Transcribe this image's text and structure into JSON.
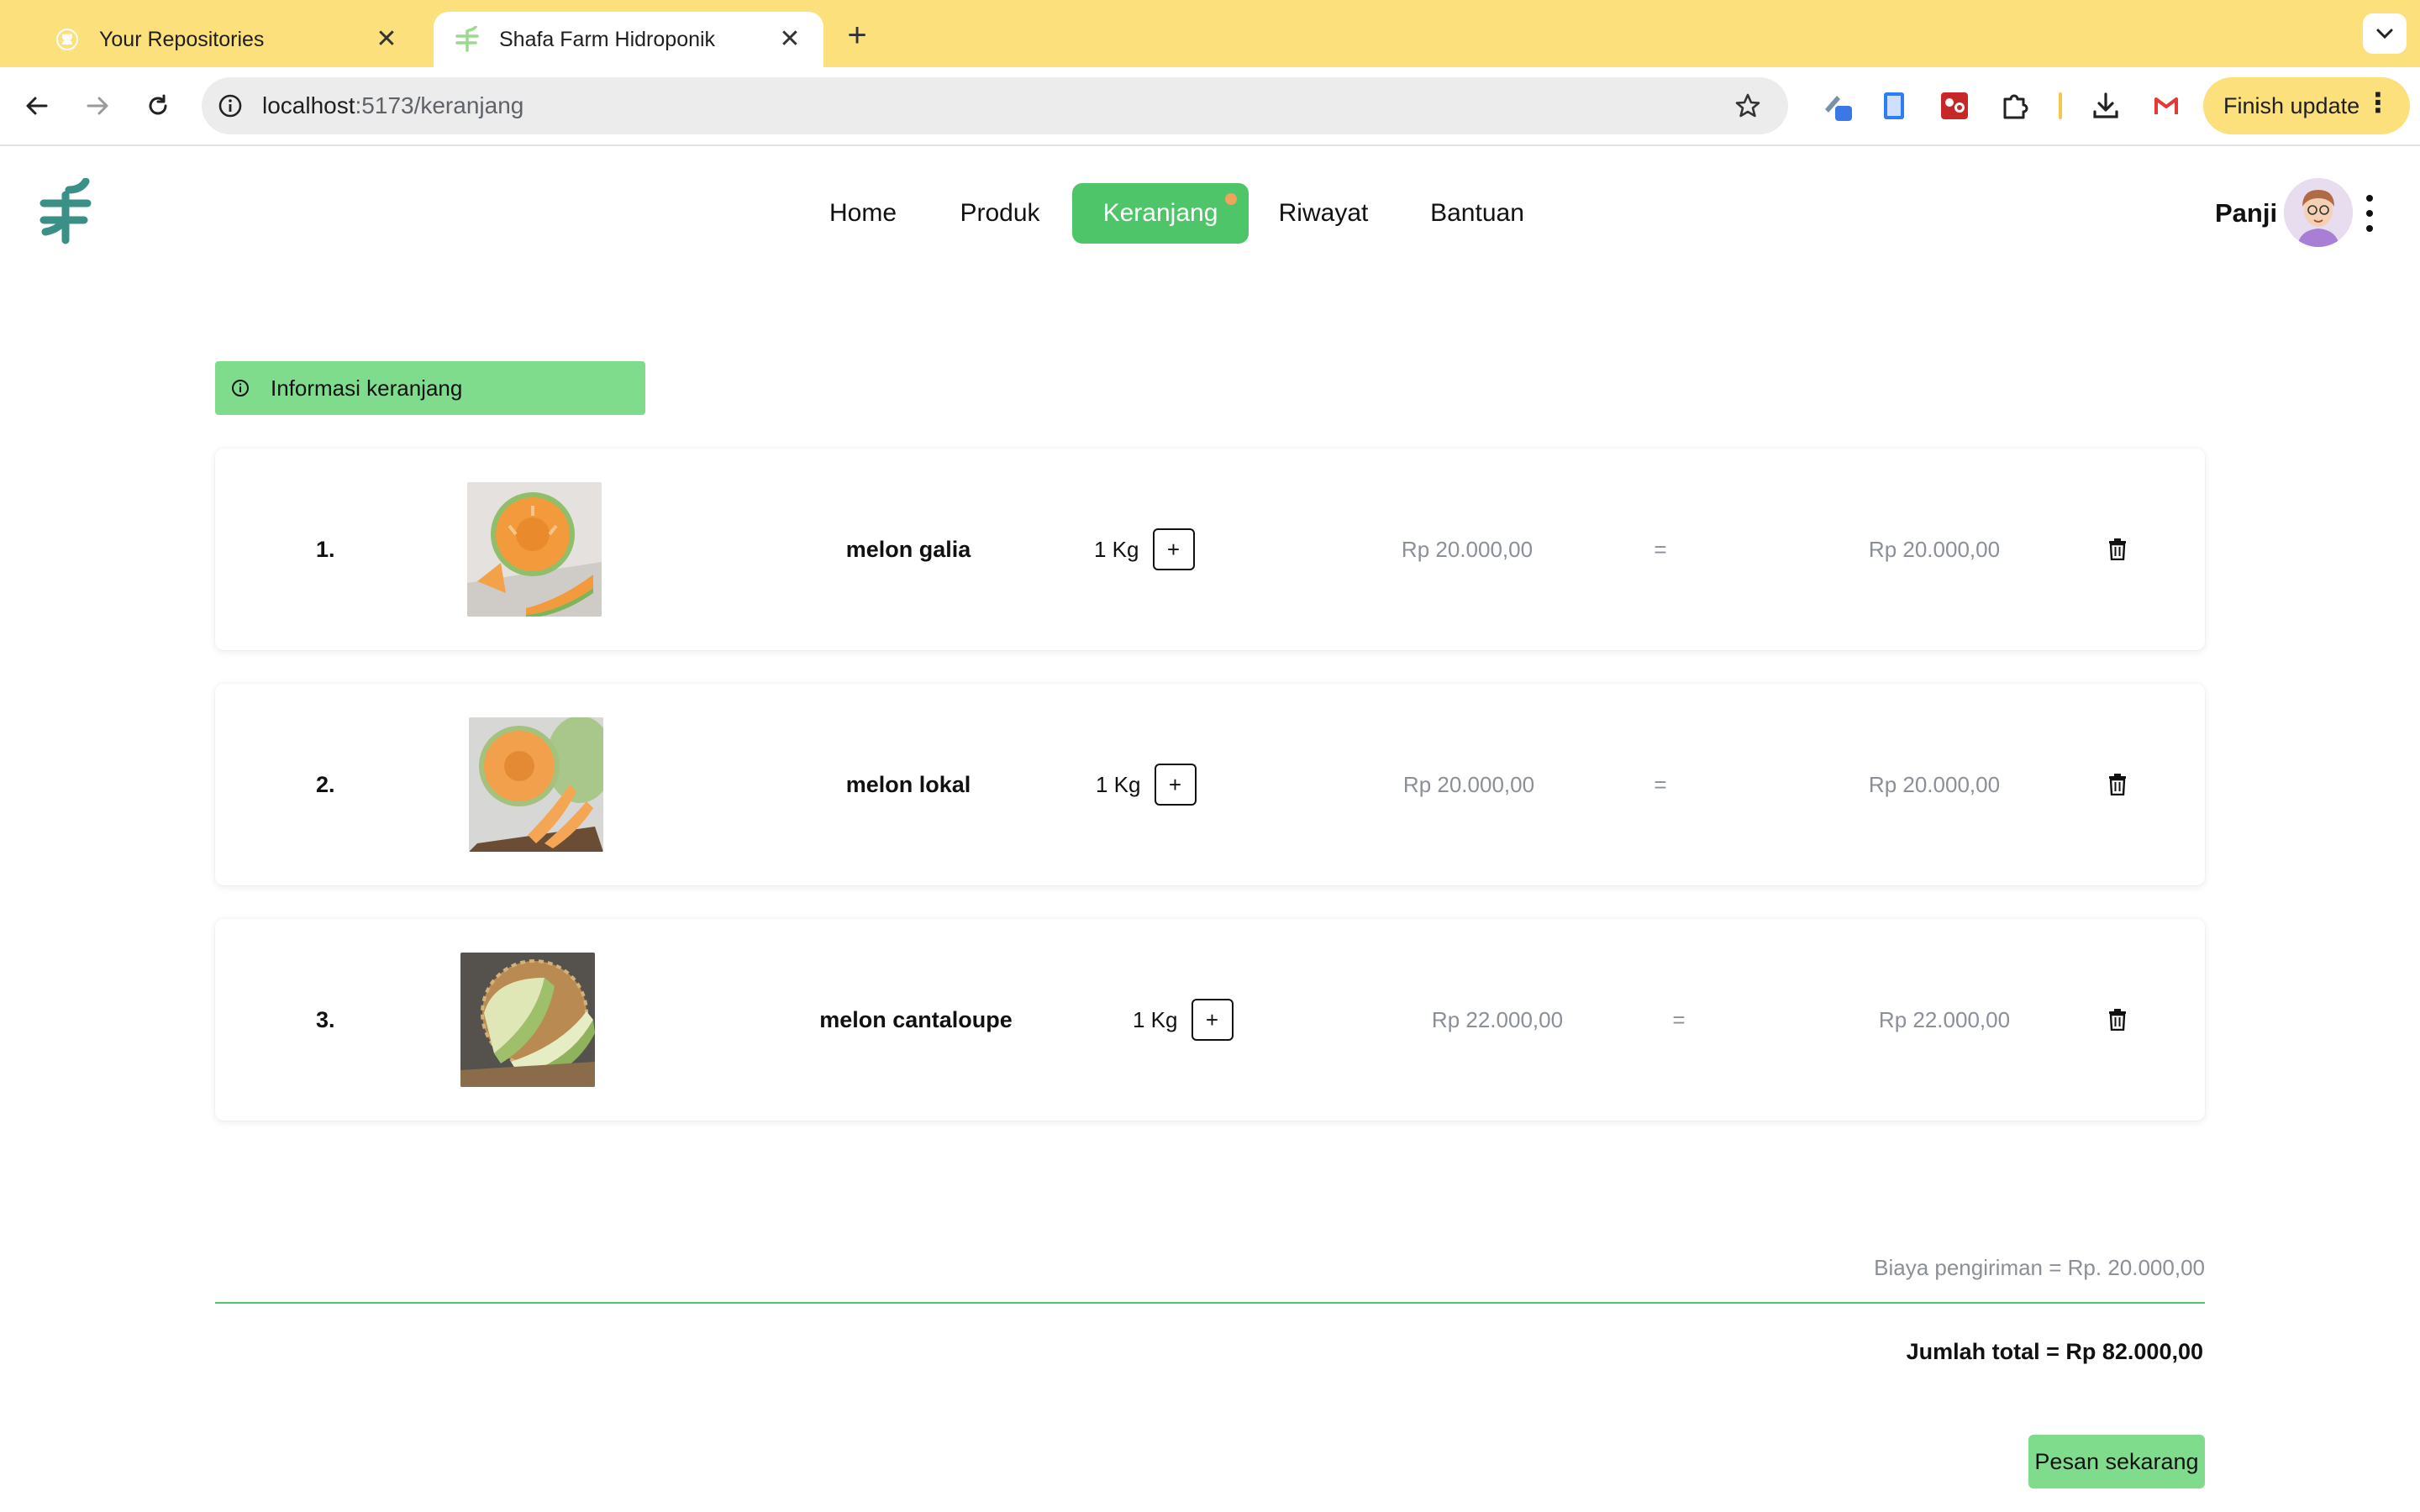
{
  "browser": {
    "tabs": [
      {
        "title": "Your Repositories",
        "favicon": "github-icon",
        "active": false
      },
      {
        "title": "Shafa Farm Hidroponik",
        "favicon": "shafa-farm-icon",
        "active": true
      }
    ],
    "url_host": "localhost",
    "url_path": ":5173/keranjang",
    "finish_update_label": "Finish update"
  },
  "header": {
    "nav": [
      {
        "label": "Home",
        "active": false
      },
      {
        "label": "Produk",
        "active": false
      },
      {
        "label": "Keranjang",
        "active": true,
        "badge": true
      },
      {
        "label": "Riwayat",
        "active": false
      },
      {
        "label": "Bantuan",
        "active": false
      }
    ],
    "user_name": "Panji"
  },
  "cart": {
    "info_label": "Informasi keranjang",
    "items": [
      {
        "number": "1.",
        "name": "melon galia",
        "qty": "1 Kg",
        "price": "Rp 20.000,00",
        "equals": "=",
        "subtotal": "Rp 20.000,00"
      },
      {
        "number": "2.",
        "name": "melon lokal",
        "qty": "1 Kg",
        "price": "Rp 20.000,00",
        "equals": "=",
        "subtotal": "Rp 20.000,00"
      },
      {
        "number": "3.",
        "name": "melon cantaloupe",
        "qty": "1 Kg",
        "price": "Rp 22.000,00",
        "equals": "=",
        "subtotal": "Rp 22.000,00"
      }
    ],
    "plus_label": "+",
    "shipping": "Biaya pengiriman = Rp. 20.000,00",
    "total": "Jumlah total = Rp 82.000,00",
    "order_button": "Pesan sekarang"
  },
  "colors": {
    "tabstrip": "#fbe07c",
    "accent_green": "#4fc56a",
    "light_green": "#7fdc8c",
    "logo_teal": "#3a8f87",
    "muted_text": "#8a8f98"
  }
}
